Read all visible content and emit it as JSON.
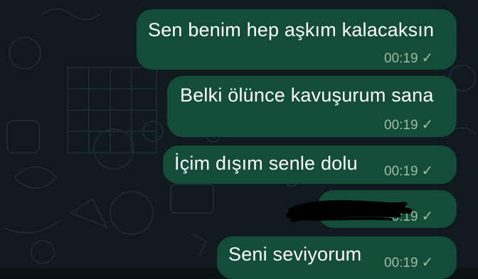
{
  "theme": {
    "bubble_color": "#144d37",
    "wallpaper_color": "#10191e",
    "meta_color": "#9fb8ac"
  },
  "messages": [
    {
      "text": "Sen benim hep aşkım kalacaksın",
      "time": "00:19",
      "status_icon": "check-icon",
      "status": "sent"
    },
    {
      "text": "Belki ölünce kavuşurum sana",
      "time": "00:19",
      "status_icon": "check-icon",
      "status": "sent"
    },
    {
      "text": "İçim dışım senle dolu",
      "time": "00:19",
      "status_icon": "check-icon",
      "status": "sent"
    },
    {
      "text": "",
      "time": "00:19",
      "status_icon": "check-icon",
      "status": "sent",
      "redacted": true
    },
    {
      "text": "Seni seviyorum",
      "time": "00:19",
      "status_icon": "check-icon",
      "status": "sent"
    }
  ]
}
